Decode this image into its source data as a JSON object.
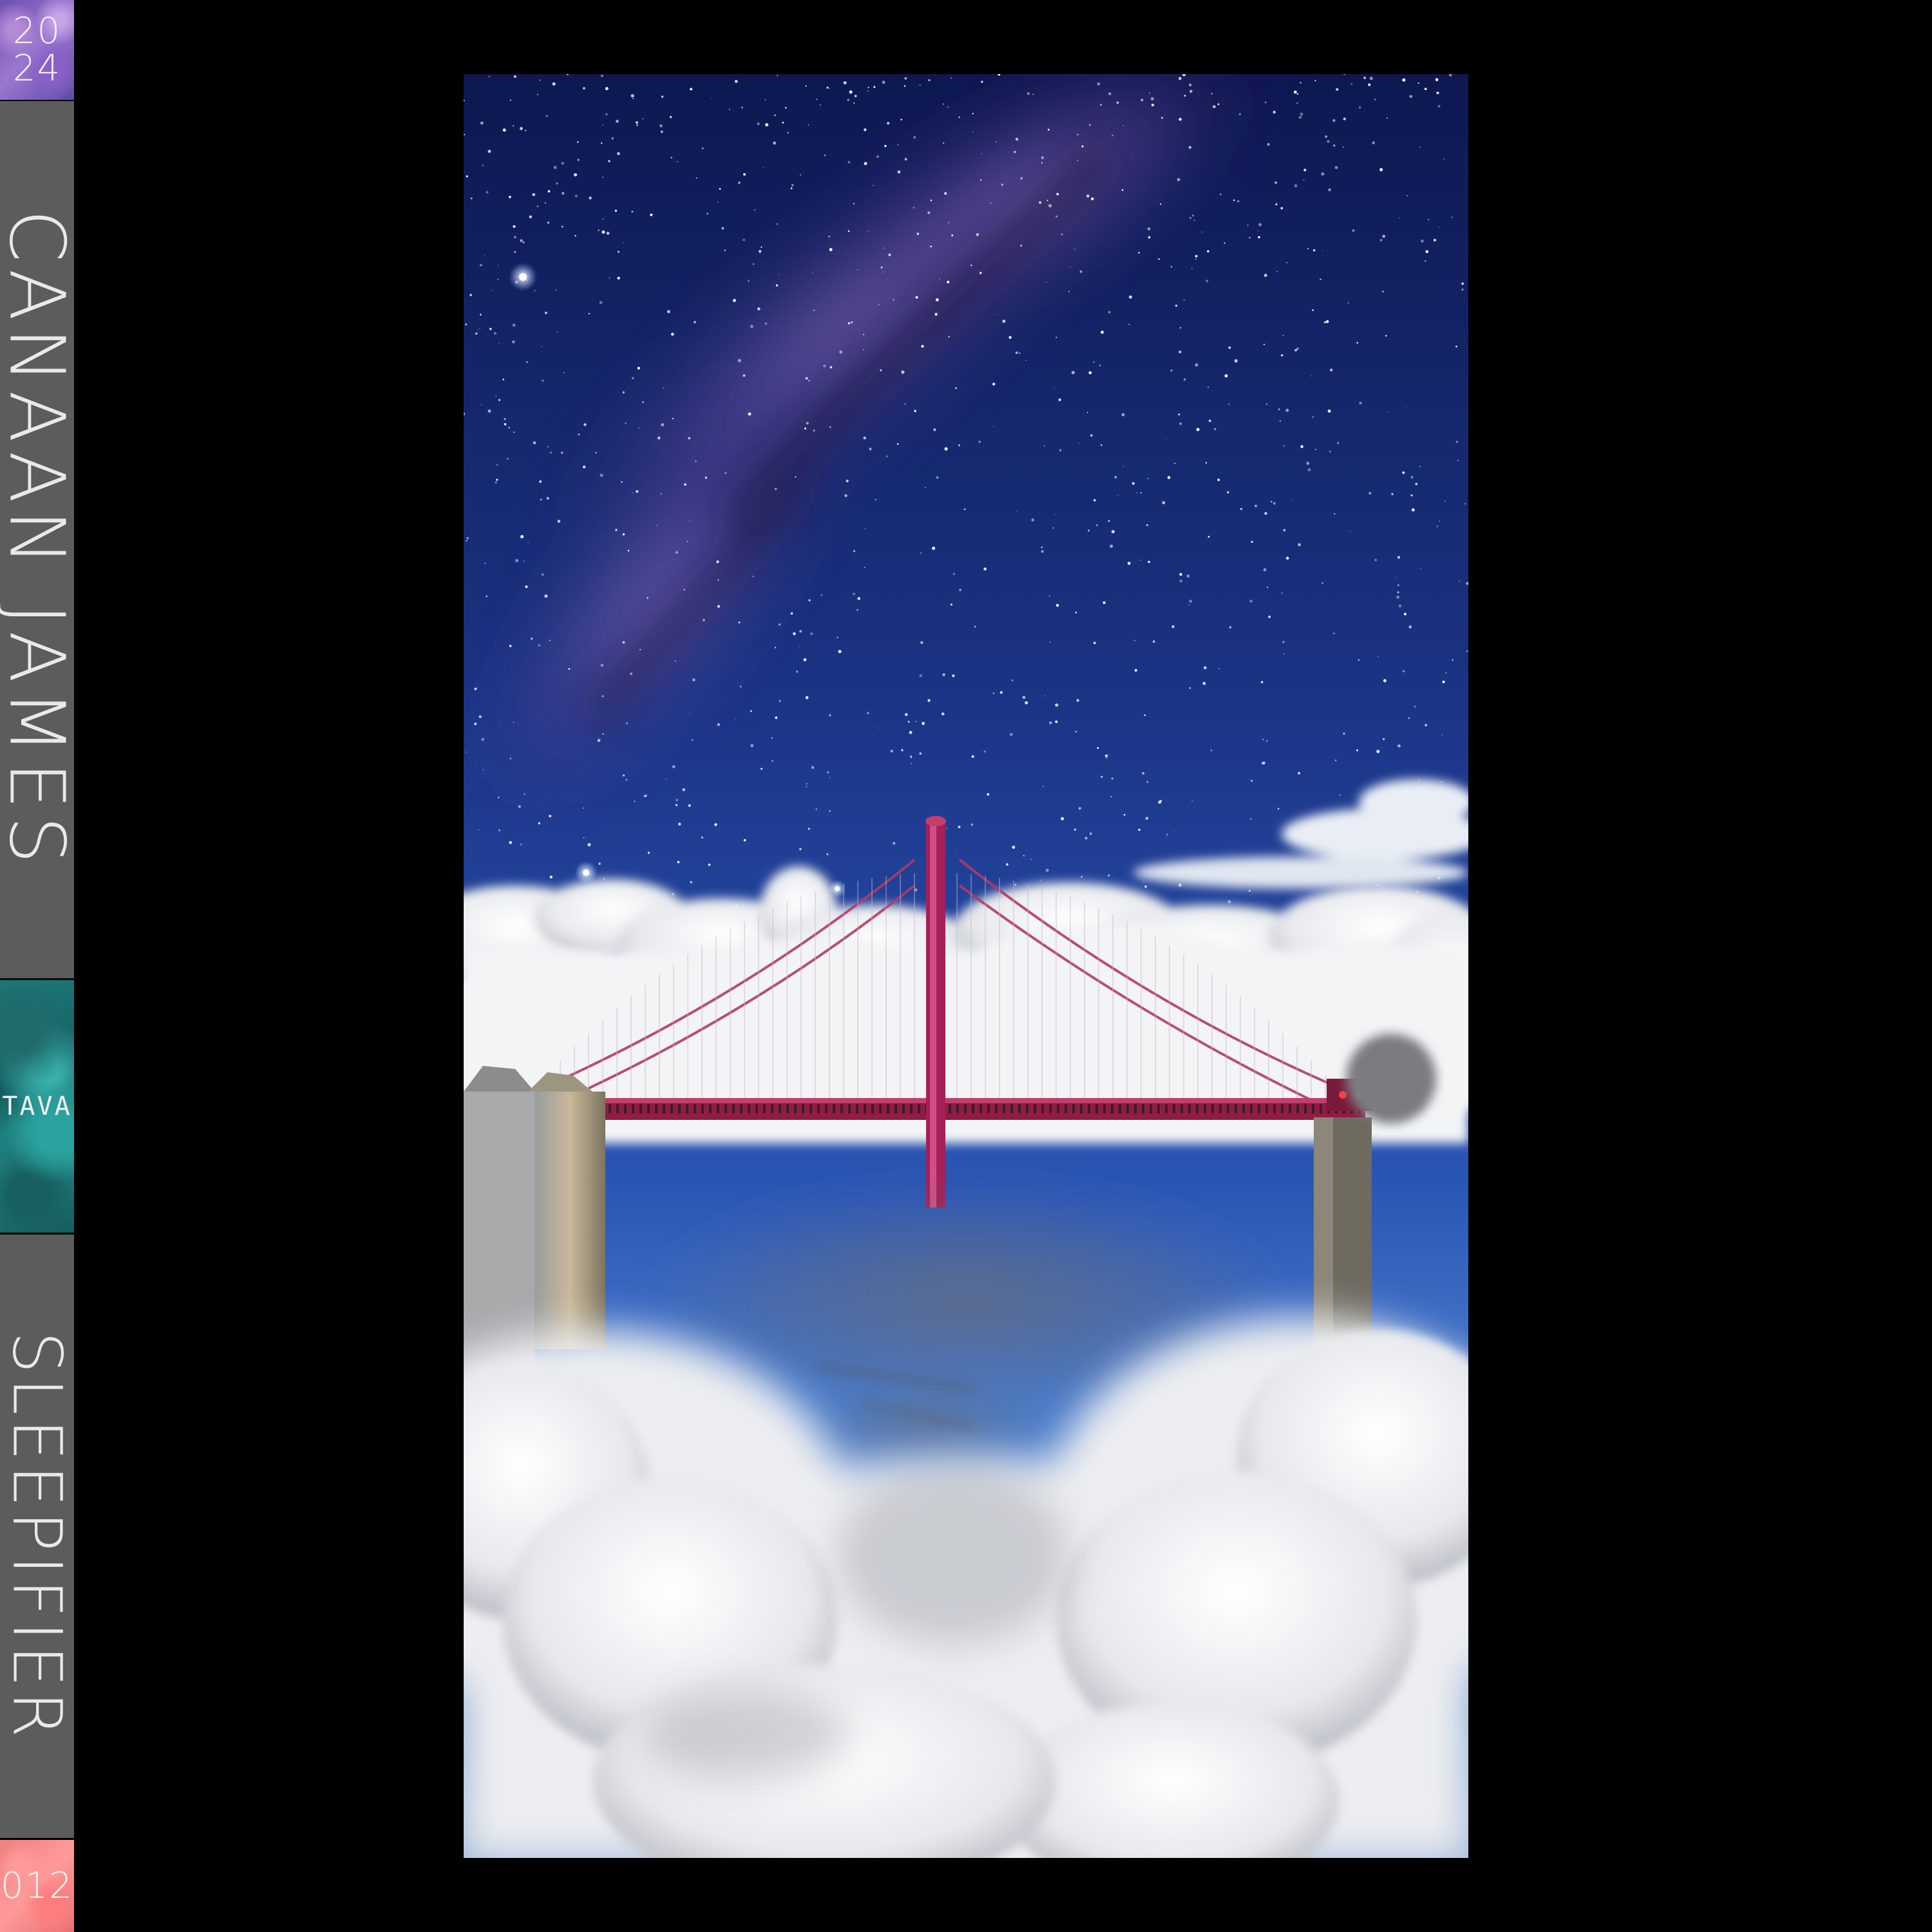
{
  "spine": {
    "year_top": "20",
    "year_bottom": "24",
    "artist": "CANAAN JAMES",
    "label": "TAVA",
    "title": "SLEEPIFIER",
    "catalog": "012"
  },
  "artwork": {
    "subject": "suspension-bridge-above-clouds-under-milky-way",
    "colors": {
      "sky_top": "#0f1b55",
      "sky_bottom": "#2a56b8",
      "milky_way": "#7b5bb0",
      "bridge": "#a4205a",
      "cloud": "#ecedf0"
    }
  }
}
